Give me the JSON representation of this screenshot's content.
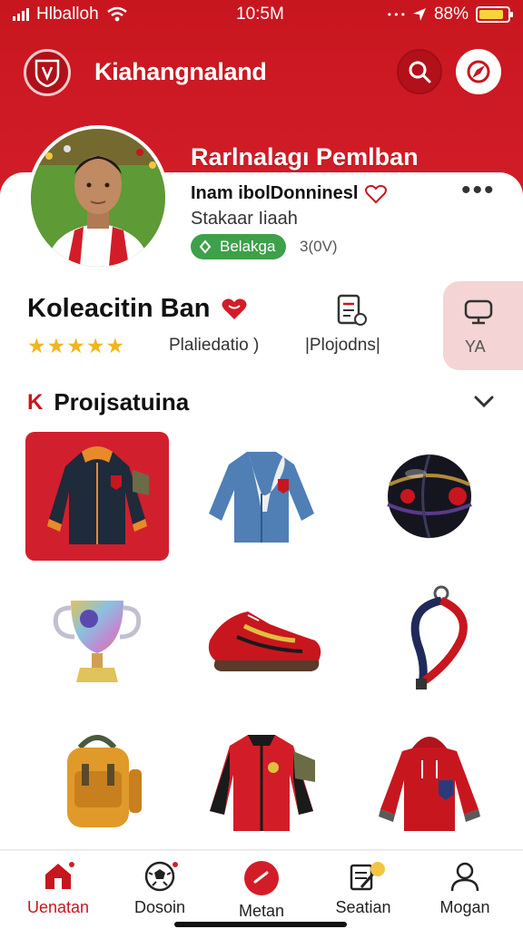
{
  "status_bar": {
    "carrier": "Hlballoh",
    "time": "10:5M",
    "battery": "88%",
    "battery_level": 0.88
  },
  "header": {
    "title": "Kiahangnaland",
    "icons": [
      "club-crest-icon",
      "search-icon",
      "compass-icon"
    ]
  },
  "profile": {
    "name": "Rarlnalagı Pemlban",
    "line1": "Inam ibolDonninesl",
    "line2": "Stakaar Iiaah",
    "badge": "Belakga",
    "badge_count": "3(0V)"
  },
  "collection": {
    "title": "Koleacitin Ban",
    "rating_stars": 5,
    "stars_text": "★★★★★",
    "rank_label": "Plaliedatio )",
    "doc_label": "|Plojodns|",
    "side_value": "YA"
  },
  "section": {
    "prefix": "K",
    "title": "Proıjsatuina"
  },
  "products": [
    {
      "item": "jacket-navy-orange",
      "selected": true
    },
    {
      "item": "denim-jacket-scarf",
      "selected": false
    },
    {
      "item": "ball-black-striped",
      "selected": false
    },
    {
      "item": "trophy-cup",
      "selected": false
    },
    {
      "item": "sneaker-red",
      "selected": false
    },
    {
      "item": "lanyard-strap",
      "selected": false
    },
    {
      "item": "backpack-orange",
      "selected": false
    },
    {
      "item": "jacket-red-black",
      "selected": false
    },
    {
      "item": "hoodie-red",
      "selected": false
    }
  ],
  "bottom_nav": [
    {
      "label": "Uenatan",
      "icon": "home-icon",
      "active": true
    },
    {
      "label": "Dosoin",
      "icon": "football-icon",
      "active": false
    },
    {
      "label": "Metan",
      "icon": "record-icon",
      "active": false
    },
    {
      "label": "Seatian",
      "icon": "note-icon",
      "active": false
    },
    {
      "label": "Mogan",
      "icon": "user-icon",
      "active": false
    }
  ],
  "colors": {
    "brand_red": "#c8161f",
    "badge_green": "#3ea04a",
    "star_gold": "#f2b51c",
    "side_tab": "#f4d4d4"
  }
}
